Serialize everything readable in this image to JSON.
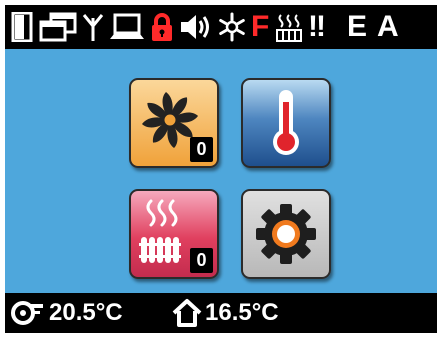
{
  "status_bar": {
    "icons": [
      "door-icon",
      "windows-icon",
      "antenna-icon",
      "laptop-icon",
      "lock-icon",
      "speaker-icon",
      "snowflake-icon",
      "heating-icon"
    ],
    "fault_letter": "F",
    "alarm_text": "!!",
    "letter_e": "E",
    "letter_a": "A",
    "colors": {
      "fault": "#ff2a2a",
      "lock": "#ff2a2a",
      "icon": "#ffffff"
    }
  },
  "tiles": {
    "fan": {
      "icon": "fan-icon",
      "badge": "0"
    },
    "temperature": {
      "icon": "thermometer-icon"
    },
    "heater": {
      "icon": "radiator-icon",
      "badge": "0"
    },
    "settings": {
      "icon": "gear-icon"
    }
  },
  "bottom_bar": {
    "outdoor_temp": "20.5°C",
    "indoor_temp": "16.5°C",
    "icons": [
      "outdoor-unit-icon",
      "house-icon"
    ]
  },
  "colors": {
    "screen_bg": "#4ea7dc",
    "bar_bg": "#000000"
  }
}
